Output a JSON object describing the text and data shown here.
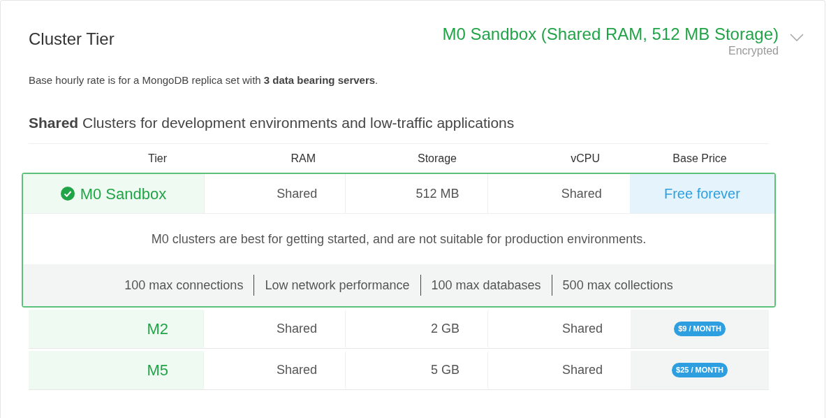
{
  "section": {
    "title": "Cluster Tier",
    "selection": "M0 Sandbox (Shared RAM, 512 MB Storage)",
    "selection_note": "Encrypted",
    "expanded": false
  },
  "rate_note": "Base hourly rate is for a MongoDB replica set with **3 data bearing servers**.",
  "group": {
    "heading": "**Shared** Clusters for development environments and low-traffic applications"
  },
  "table": {
    "columns": [
      "Tier",
      "RAM",
      "Storage",
      "vCPU",
      "Base Price"
    ],
    "rows": [
      {
        "tier": "M0 Sandbox",
        "ram": "Shared",
        "storage": "512 MB",
        "vcpu": "Shared",
        "price": "Free forever",
        "kind": "text",
        "selected": true,
        "description": "M0 clusters are best for getting started, and are not suitable for production environments.",
        "features": [
          "100 max connections",
          "Low network performance",
          "100 max databases",
          "500 max collections"
        ]
      },
      {
        "tier": "M2",
        "ram": "Shared",
        "storage": "2 GB",
        "vcpu": "Shared",
        "price": "$9 / MONTH",
        "kind": "badge",
        "selected": false
      },
      {
        "tier": "M5",
        "ram": "Shared",
        "storage": "5 GB",
        "vcpu": "Shared",
        "price": "$25 / MONTH",
        "kind": "badge",
        "selected": false
      }
    ]
  }
}
